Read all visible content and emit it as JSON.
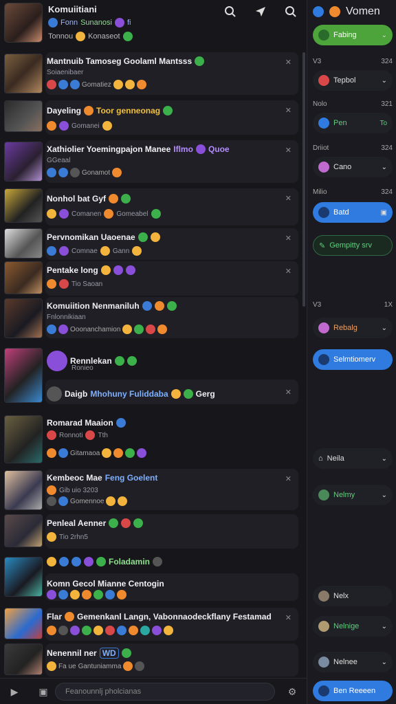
{
  "header": {
    "title": "Komuiitiani",
    "sub1": "Fonn",
    "sub1_tag": "Sunanosi",
    "sub1_tail": "fi",
    "sub2": "Tonnou",
    "sub2_b": "Konaseot"
  },
  "rows": [
    {
      "title": "Mantnuib Tamoseg Goolaml Mantsss",
      "meta": "Soiaenibaer",
      "emoji": "Gomatiez"
    },
    {
      "title": "Dayeling",
      "title_b": "Toor genneonag",
      "meta": "Gomanei",
      "emoji": ""
    },
    {
      "title": "Xathiolier Yoemingpajon Manee",
      "title_b": "Iflmo",
      "title_c": "Quoe",
      "meta": "GGeaal",
      "emoji": "Gonamot"
    },
    {
      "title": "Nonhol bat Gyf",
      "meta": "Comanen",
      "emoji": "Gomeabel"
    },
    {
      "title": "Pervnomikan Uaoenae",
      "meta": "Comnae",
      "emoji": "Gann"
    },
    {
      "title": "Pentake long",
      "meta": "Tio Saoan",
      "emoji": ""
    },
    {
      "title": "Komuiition Nenmaniluh",
      "meta": "Fnlonnikiaan",
      "emoji": "Ooonanchamion"
    },
    {
      "title": "Rennlekan",
      "meta": "Ronieo",
      "emoji": ""
    },
    {
      "title": "Daigb",
      "title_b": "Mhohuny Fuliddaba",
      "title_c": "Gerg",
      "meta": "",
      "emoji": ""
    },
    {
      "title": "Romarad Maaion",
      "meta": "Ronnoti",
      "meta_b": "Tth",
      "emoji": "Gitamaoa"
    },
    {
      "title": "Kembeoc Mae",
      "title_b": "Feng Goelent",
      "meta": "Gib uio 3203",
      "emoji": "Gomennoe"
    },
    {
      "title": "Penleal Aenner",
      "meta": "Tio 2rhn5",
      "emoji": ""
    },
    {
      "title": "Foladamin",
      "meta": "",
      "emoji": ""
    },
    {
      "title": "Komn Gecol Mianne Centogin",
      "meta": "",
      "emoji": ""
    },
    {
      "title": "Flar",
      "title_b": "Gemenkanl Langn, Vabonnaodeckflany Festamad",
      "meta": "",
      "emoji": ""
    },
    {
      "title": "Nenennil ner",
      "title_b": "WD",
      "meta": "Fa ue",
      "emoji": "Gantuniamma"
    }
  ],
  "bottom": {
    "placeholder": "Feanounnlj pholcianas"
  },
  "right": {
    "top_label": "Vomen",
    "items": [
      {
        "label": "Fabing",
        "style": "green"
      },
      {
        "label": "Tepbol",
        "style": "dark"
      },
      {
        "label": "Pen",
        "style": "dark",
        "value": "To"
      },
      {
        "label": "Cano",
        "style": "dark"
      },
      {
        "label": "Batd",
        "style": "blue"
      },
      {
        "label": "Gempitty srv",
        "style": "outline"
      },
      {
        "label": "Rebalg",
        "style": "dark"
      },
      {
        "label": "Selmtiomerv",
        "style": "blue"
      },
      {
        "label": "Neila",
        "style": "dark"
      },
      {
        "label": "Nelmy",
        "style": "dark"
      },
      {
        "label": "Nelx",
        "style": "dark"
      },
      {
        "label": "Nelnige",
        "style": "dark"
      },
      {
        "label": "Nelnee",
        "style": "dark"
      },
      {
        "label": "Ben Reeeen",
        "style": "blue"
      }
    ],
    "labels": [
      {
        "left": "V3",
        "right": "324"
      },
      {
        "left": "Nolo",
        "right": "321"
      },
      {
        "left": "Driiot",
        "right": "324"
      },
      {
        "left": "Milio",
        "right": "324"
      },
      {
        "left": "V3",
        "right": "1X"
      }
    ]
  }
}
